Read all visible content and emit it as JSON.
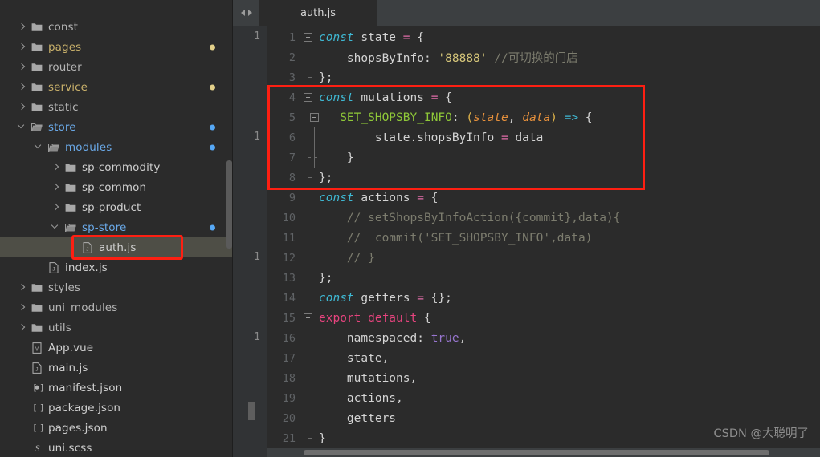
{
  "window": {
    "theme_bg": "#2b2b2b",
    "accent_highlight": "#fd1f12"
  },
  "sidebar": {
    "scrollbar_present": true,
    "items": [
      {
        "label": "const",
        "indent": 1,
        "type": "folder",
        "arrow": "right",
        "color": "grey",
        "dot": ""
      },
      {
        "label": "pages",
        "indent": 1,
        "type": "folder",
        "arrow": "right",
        "color": "yellow",
        "dot": "yellow"
      },
      {
        "label": "router",
        "indent": 1,
        "type": "folder",
        "arrow": "right",
        "color": "grey",
        "dot": ""
      },
      {
        "label": "service",
        "indent": 1,
        "type": "folder",
        "arrow": "right",
        "color": "yellow",
        "dot": "yellow"
      },
      {
        "label": "static",
        "indent": 1,
        "type": "folder",
        "arrow": "right",
        "color": "grey",
        "dot": ""
      },
      {
        "label": "store",
        "indent": 1,
        "type": "folder-open",
        "arrow": "down",
        "color": "blue",
        "dot": "blue"
      },
      {
        "label": "modules",
        "indent": 2,
        "type": "folder-open",
        "arrow": "down",
        "color": "blue",
        "dot": "blue"
      },
      {
        "label": "sp-commodity",
        "indent": 3,
        "type": "folder",
        "arrow": "right",
        "color": "white",
        "dot": ""
      },
      {
        "label": "sp-common",
        "indent": 3,
        "type": "folder",
        "arrow": "right",
        "color": "white",
        "dot": ""
      },
      {
        "label": "sp-product",
        "indent": 3,
        "type": "folder",
        "arrow": "right",
        "color": "white",
        "dot": ""
      },
      {
        "label": "sp-store",
        "indent": 3,
        "type": "folder-open",
        "arrow": "down",
        "color": "blue",
        "dot": "blue"
      },
      {
        "label": "auth.js",
        "indent": 4,
        "type": "js",
        "arrow": "none",
        "color": "white",
        "dot": "",
        "selected": true
      },
      {
        "label": "index.js",
        "indent": 2,
        "type": "js",
        "arrow": "none",
        "color": "white",
        "dot": ""
      },
      {
        "label": "styles",
        "indent": 1,
        "type": "folder",
        "arrow": "right",
        "color": "grey",
        "dot": ""
      },
      {
        "label": "uni_modules",
        "indent": 1,
        "type": "folder",
        "arrow": "right",
        "color": "grey",
        "dot": ""
      },
      {
        "label": "utils",
        "indent": 1,
        "type": "folder",
        "arrow": "right",
        "color": "grey",
        "dot": ""
      },
      {
        "label": "App.vue",
        "indent": 1,
        "type": "vue",
        "arrow": "none",
        "color": "white",
        "dot": ""
      },
      {
        "label": "main.js",
        "indent": 1,
        "type": "js",
        "arrow": "none",
        "color": "white",
        "dot": ""
      },
      {
        "label": "manifest.json",
        "indent": 1,
        "type": "manifest",
        "arrow": "none",
        "color": "white",
        "dot": ""
      },
      {
        "label": "package.json",
        "indent": 1,
        "type": "json",
        "arrow": "none",
        "color": "white",
        "dot": ""
      },
      {
        "label": "pages.json",
        "indent": 1,
        "type": "json",
        "arrow": "none",
        "color": "white",
        "dot": ""
      },
      {
        "label": "uni.scss",
        "indent": 1,
        "type": "scss",
        "arrow": "none",
        "color": "white",
        "dot": ""
      }
    ]
  },
  "editor": {
    "tab": {
      "label": "auth.js",
      "active": true
    },
    "nav": {
      "back_icon": "chevron-left-icon",
      "forward_icon": "chevron-right-icon"
    },
    "annotation_gutter": {
      "markers": [
        "1",
        "1",
        "1",
        "1"
      ]
    },
    "highlight_box_lines": [
      4,
      8
    ],
    "lines": [
      {
        "n": 1,
        "fold": "box",
        "tokens": [
          {
            "t": "const ",
            "c": "t-const"
          },
          {
            "t": "state ",
            "c": "t-plain"
          },
          {
            "t": "=",
            "c": "t-op"
          },
          {
            "t": " {",
            "c": "t-brace"
          }
        ]
      },
      {
        "n": 2,
        "fold": "line",
        "tokens": [
          {
            "t": "    shopsByInfo: ",
            "c": "t-plain"
          },
          {
            "t": "'88888'",
            "c": "t-str"
          },
          {
            "t": " //可切换的门店",
            "c": "t-com"
          }
        ]
      },
      {
        "n": 3,
        "fold": "end",
        "tokens": [
          {
            "t": "};",
            "c": "t-brace"
          }
        ]
      },
      {
        "n": 4,
        "fold": "box",
        "tokens": [
          {
            "t": "const ",
            "c": "t-const"
          },
          {
            "t": "mutations ",
            "c": "t-plain"
          },
          {
            "t": "=",
            "c": "t-op"
          },
          {
            "t": " {",
            "c": "t-brace"
          }
        ]
      },
      {
        "n": 5,
        "fold": "box2",
        "tokens": [
          {
            "t": "   ",
            "c": "t-plain"
          },
          {
            "t": "SET_SHOPSBY_INFO",
            "c": "t-fn"
          },
          {
            "t": ": ",
            "c": "t-plain"
          },
          {
            "t": "(",
            "c": "t-paren"
          },
          {
            "t": "state",
            "c": "t-param"
          },
          {
            "t": ", ",
            "c": "t-plain"
          },
          {
            "t": "data",
            "c": "t-param"
          },
          {
            "t": ")",
            "c": "t-paren"
          },
          {
            "t": " ",
            "c": "t-plain"
          },
          {
            "t": "=>",
            "c": "t-arrow"
          },
          {
            "t": " {",
            "c": "t-brace"
          }
        ]
      },
      {
        "n": 6,
        "fold": "line",
        "tokens": [
          {
            "t": "        state.shopsByInfo ",
            "c": "t-plain"
          },
          {
            "t": "=",
            "c": "t-op"
          },
          {
            "t": " data",
            "c": "t-plain"
          }
        ]
      },
      {
        "n": 7,
        "fold": "mid",
        "tokens": [
          {
            "t": "    }",
            "c": "t-brace"
          }
        ]
      },
      {
        "n": 8,
        "fold": "end",
        "tokens": [
          {
            "t": "};",
            "c": "t-brace"
          }
        ]
      },
      {
        "n": 9,
        "fold": "",
        "tokens": [
          {
            "t": "const ",
            "c": "t-const"
          },
          {
            "t": "actions ",
            "c": "t-plain"
          },
          {
            "t": "=",
            "c": "t-op"
          },
          {
            "t": " {",
            "c": "t-brace"
          }
        ]
      },
      {
        "n": 10,
        "fold": "",
        "tokens": [
          {
            "t": "    // setShopsByInfoAction({commit},data){",
            "c": "t-com"
          }
        ]
      },
      {
        "n": 11,
        "fold": "",
        "tokens": [
          {
            "t": "    //  commit('SET_SHOPSBY_INFO',data)",
            "c": "t-com"
          }
        ]
      },
      {
        "n": 12,
        "fold": "",
        "tokens": [
          {
            "t": "    // }",
            "c": "t-com"
          }
        ]
      },
      {
        "n": 13,
        "fold": "",
        "tokens": [
          {
            "t": "};",
            "c": "t-brace"
          }
        ]
      },
      {
        "n": 14,
        "fold": "",
        "tokens": [
          {
            "t": "const ",
            "c": "t-const"
          },
          {
            "t": "getters ",
            "c": "t-plain"
          },
          {
            "t": "=",
            "c": "t-op"
          },
          {
            "t": " {};",
            "c": "t-brace"
          }
        ]
      },
      {
        "n": 15,
        "fold": "box",
        "tokens": [
          {
            "t": "export default",
            "c": "t-export"
          },
          {
            "t": " {",
            "c": "t-brace"
          }
        ]
      },
      {
        "n": 16,
        "fold": "line",
        "tokens": [
          {
            "t": "    namespaced: ",
            "c": "t-plain"
          },
          {
            "t": "true",
            "c": "t-bool"
          },
          {
            "t": ",",
            "c": "t-plain"
          }
        ]
      },
      {
        "n": 17,
        "fold": "line",
        "tokens": [
          {
            "t": "    state,",
            "c": "t-plain"
          }
        ]
      },
      {
        "n": 18,
        "fold": "line",
        "tokens": [
          {
            "t": "    mutations,",
            "c": "t-plain"
          }
        ]
      },
      {
        "n": 19,
        "fold": "line",
        "tokens": [
          {
            "t": "    actions,",
            "c": "t-plain"
          }
        ]
      },
      {
        "n": 20,
        "fold": "line",
        "tokens": [
          {
            "t": "    getters",
            "c": "t-plain"
          }
        ]
      },
      {
        "n": 21,
        "fold": "end",
        "tokens": [
          {
            "t": "}",
            "c": "t-brace"
          }
        ]
      }
    ]
  },
  "watermark": {
    "text": "CSDN @大聪明了"
  }
}
